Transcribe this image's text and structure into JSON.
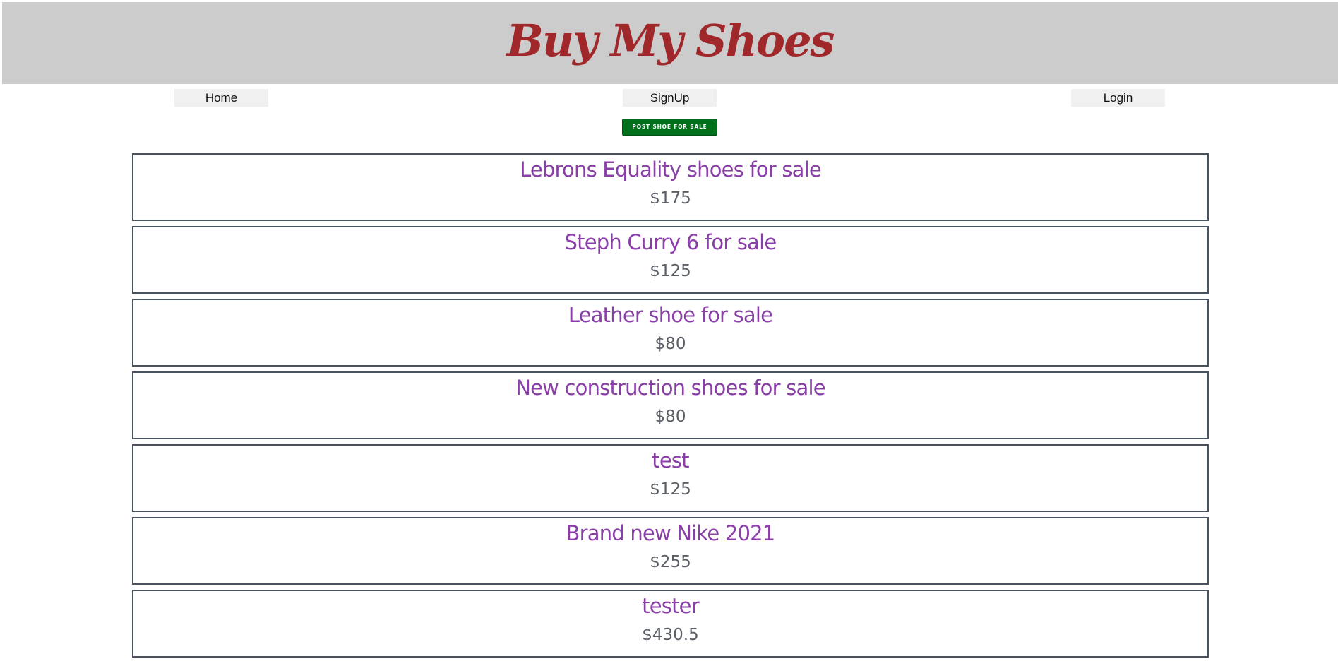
{
  "header": {
    "brand": "Buy My Shoes"
  },
  "nav": {
    "home": "Home",
    "signup": "SignUp",
    "login": "Login"
  },
  "actions": {
    "post_label": "POST SHOE FOR SALE"
  },
  "listings": [
    {
      "title": "Lebrons Equality shoes for sale",
      "price": "$175"
    },
    {
      "title": "Steph Curry 6 for sale",
      "price": "$125"
    },
    {
      "title": "Leather shoe for sale",
      "price": "$80"
    },
    {
      "title": "New construction shoes for sale",
      "price": "$80"
    },
    {
      "title": "test",
      "price": "$125"
    },
    {
      "title": "Brand new Nike 2021",
      "price": "$255"
    },
    {
      "title": "tester",
      "price": "$430.5"
    }
  ],
  "colors": {
    "header_bg": "#cccccc",
    "brand": "#a0272a",
    "post_button": "#00701a",
    "listing_title": "#8a3fa8",
    "listing_price": "#5a5f66",
    "listing_border": "#4a5360"
  }
}
